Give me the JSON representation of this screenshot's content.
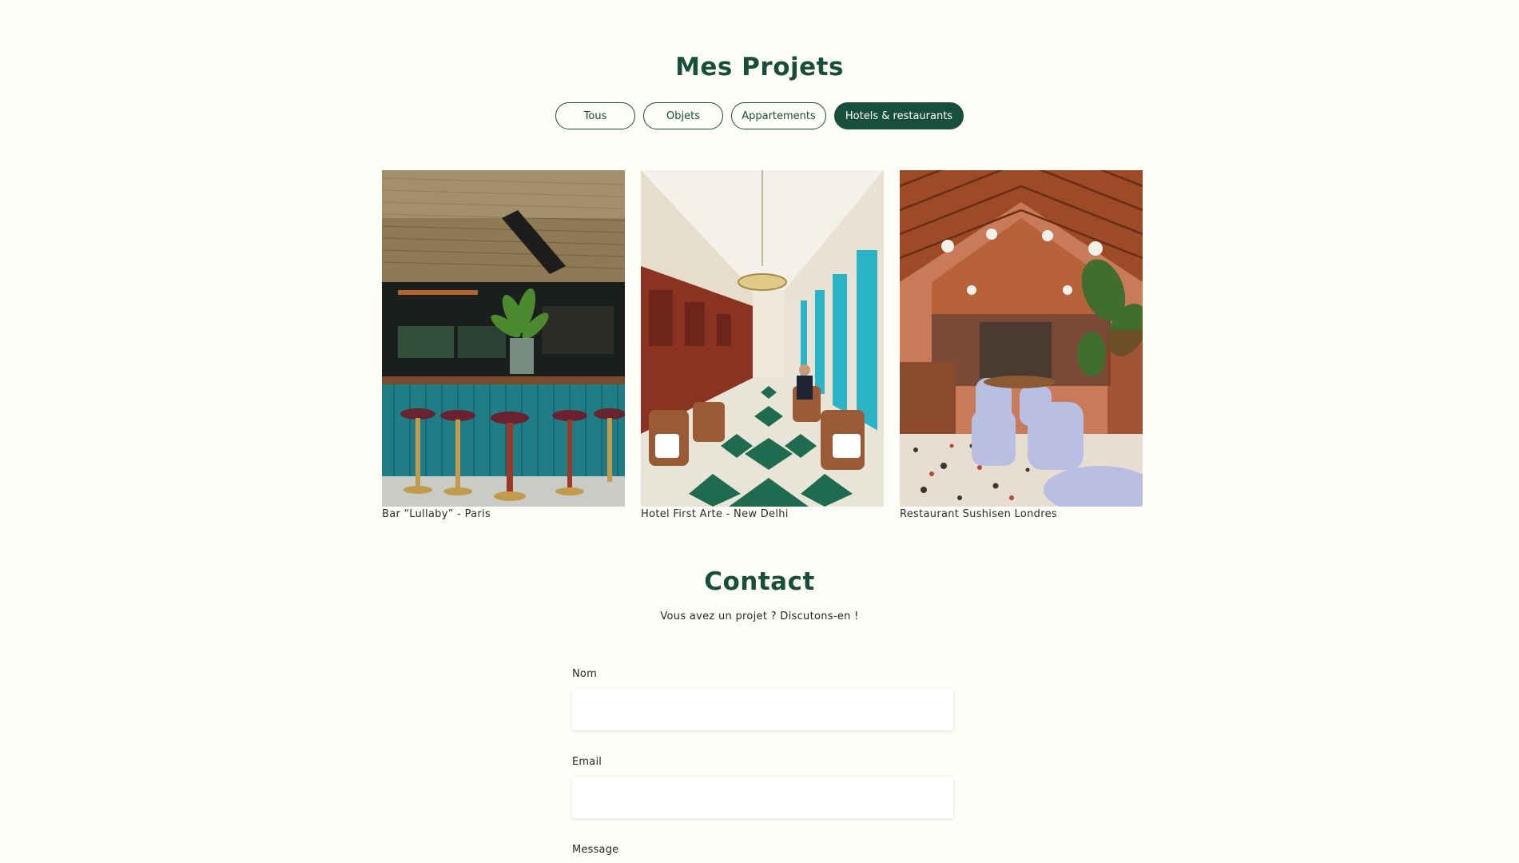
{
  "projects": {
    "title": "Mes Projets",
    "filters": [
      {
        "label": "Tous",
        "active": false
      },
      {
        "label": "Objets",
        "active": false
      },
      {
        "label": "Appartements",
        "active": false
      },
      {
        "label": "Hotels & restaurants",
        "active": true
      }
    ],
    "items": [
      {
        "caption": "Bar “Lullaby” - Paris"
      },
      {
        "caption": "Hotel First Arte - New Delhi"
      },
      {
        "caption": "Restaurant Sushisen Londres"
      }
    ]
  },
  "contact": {
    "title": "Contact",
    "subtitle": "Vous avez un projet ? Discutons-en !",
    "fields": [
      {
        "label": "Nom",
        "value": ""
      },
      {
        "label": "Email",
        "value": ""
      },
      {
        "label": "Message"
      }
    ]
  },
  "colors": {
    "accent": "#174f3b",
    "background": "#fefdf8"
  }
}
